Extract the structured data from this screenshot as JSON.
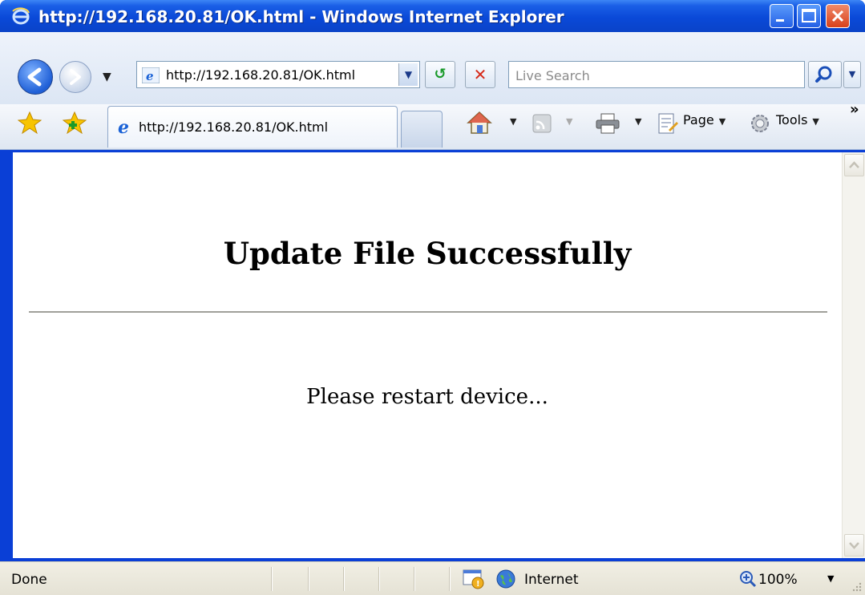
{
  "window": {
    "title": "http://192.168.20.81/OK.html - Windows Internet Explorer",
    "controls": [
      "minimize-icon",
      "maximize-icon",
      "close-icon"
    ]
  },
  "address_bar": {
    "url": "http://192.168.20.81/OK.html"
  },
  "search": {
    "placeholder": "Live Search"
  },
  "tabs": [
    {
      "label": "http://192.168.20.81/OK.html",
      "active": true
    }
  ],
  "command_bar": {
    "page_label": "Page",
    "tools_label": "Tools"
  },
  "page": {
    "heading": "Update File Successfully",
    "message": "Please restart device..."
  },
  "status_bar": {
    "status": "Done",
    "zone": "Internet",
    "zoom": "100%"
  }
}
